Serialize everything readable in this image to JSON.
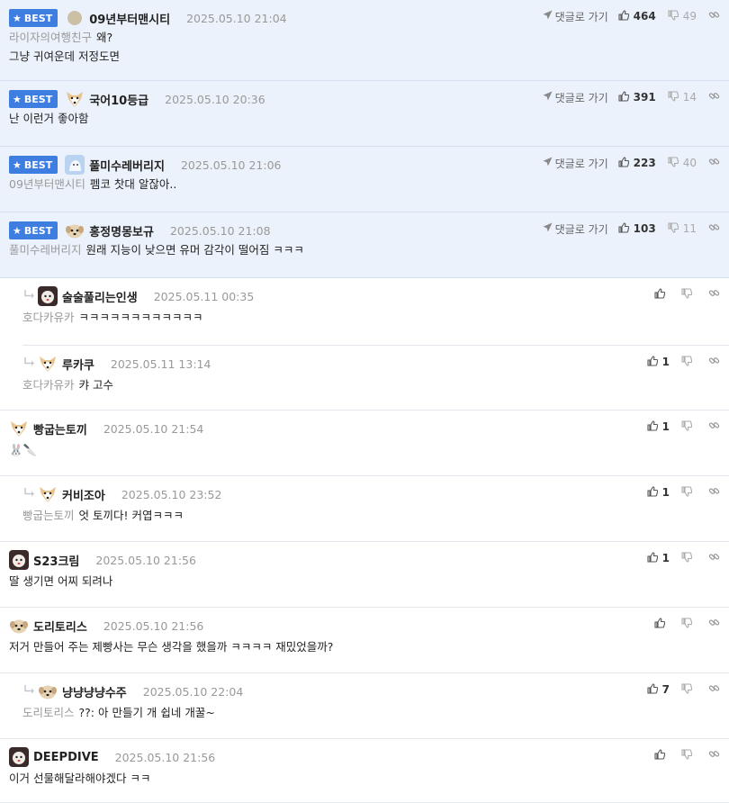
{
  "best_label": "BEST",
  "goto_label": "댓글로 가기",
  "comments": [
    {
      "type": "best",
      "avatar": "round-avatar",
      "nick": "09년부터맨시티",
      "date": "2025.05.10 21:04",
      "up": "464",
      "down": "49",
      "mention": "라이자의여행친구",
      "text": "왜?",
      "text2": "그냥 귀여운데 저정도면"
    },
    {
      "type": "best",
      "avatar": "dog-avatar",
      "nick": "국어10등급",
      "date": "2025.05.10 20:36",
      "up": "391",
      "down": "14",
      "mention": "",
      "text": "난 이런거 좋아함"
    },
    {
      "type": "best",
      "avatar": "blue-avatar",
      "nick": "풀미수레버리지",
      "date": "2025.05.10 21:06",
      "up": "223",
      "down": "40",
      "mention": "09년부터맨시티",
      "text": "펨코 찻대 알잖아.."
    },
    {
      "type": "best",
      "avatar": "puppy-avatar",
      "nick": "홍정명몽보규",
      "date": "2025.05.10 21:08",
      "up": "103",
      "down": "11",
      "mention": "풀미수레버리지",
      "text": "원래 지능이 낮으면 유머 감각이 떨어짐 ㅋㅋㅋ"
    },
    {
      "type": "reply",
      "avatar": "dark-avatar",
      "nick": "술술풀리는인생",
      "date": "2025.05.11 00:35",
      "up": "",
      "down": "",
      "mention": "호다카유카",
      "text": "ㅋㅋㅋㅋㅋㅋㅋㅋㅋㅋㅋㅋ"
    },
    {
      "type": "reply",
      "last": true,
      "avatar": "dog-avatar",
      "nick": "루카쿠",
      "date": "2025.05.11 13:14",
      "up": "1",
      "down": "",
      "mention": "호다카유카",
      "text": "캬 고수"
    },
    {
      "type": "normal",
      "avatar": "dog-avatar",
      "nick": "빵굽는토끼",
      "date": "2025.05.10 21:54",
      "up": "1",
      "down": "",
      "mention": "",
      "text": "🐰🔪"
    },
    {
      "type": "reply",
      "last": true,
      "avatar": "dog-avatar",
      "nick": "커비조아",
      "date": "2025.05.10 23:52",
      "up": "1",
      "down": "",
      "mention": "빵굽는토끼",
      "text": "엇 토끼다! 커엽ㅋㅋㅋ"
    },
    {
      "type": "normal",
      "avatar": "dark-avatar",
      "nick": "S23크림",
      "date": "2025.05.10 21:56",
      "up": "1",
      "down": "",
      "mention": "",
      "text": "딸 생기면 어찌 되려나"
    },
    {
      "type": "normal",
      "avatar": "puppy-avatar",
      "nick": "도리토리스",
      "date": "2025.05.10 21:56",
      "up": "",
      "down": "",
      "mention": "",
      "text": "저거 만들어 주는 제빵사는 무슨 생각을 했을까 ㅋㅋㅋㅋ 재밌었을까?"
    },
    {
      "type": "reply",
      "last": true,
      "avatar": "puppy-avatar",
      "nick": "냥냥냥냥수주",
      "date": "2025.05.10 22:04",
      "up": "7",
      "down": "",
      "mention": "도리토리스",
      "text": "??: 아 만들기 개 쉽네 개꿀~"
    },
    {
      "type": "normal",
      "avatar": "dark-avatar",
      "nick": "DEEPDIVE",
      "date": "2025.05.10 21:56",
      "up": "",
      "down": "",
      "mention": "",
      "text": "이거 선물해달라해야겠다 ㅋㅋ"
    }
  ]
}
